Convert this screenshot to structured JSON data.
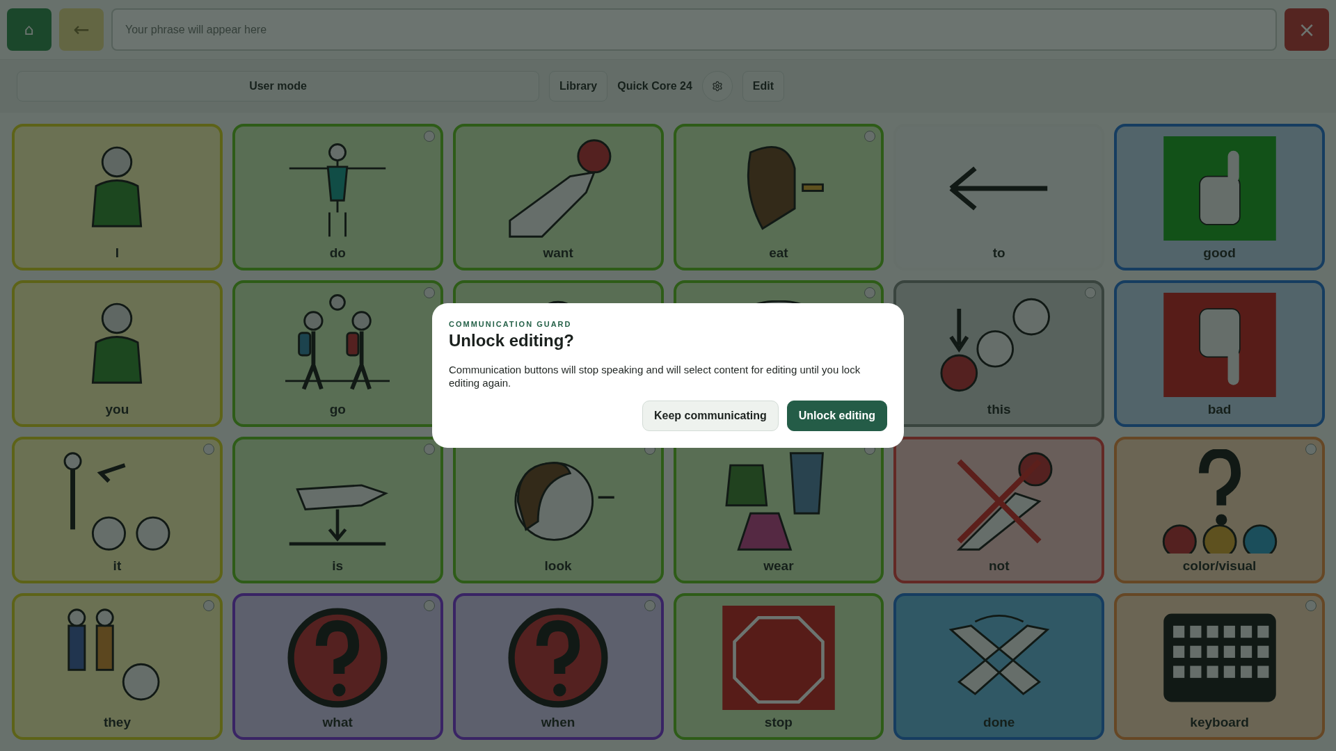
{
  "top_bar": {
    "home_button": "⌂",
    "back_button": "←",
    "phrase_field": {
      "placeholder": "Your phrase will appear here"
    },
    "clear_button": "×"
  },
  "toolbar": {
    "mode_field": "User mode",
    "library_button": "Library",
    "board_name": "Quick Core 24",
    "edit_button": "Edit"
  },
  "tiles": [
    {
      "label": "I",
      "kind": "pronoun",
      "linked": false
    },
    {
      "label": "do",
      "kind": "verb",
      "linked": true
    },
    {
      "label": "want",
      "kind": "verb",
      "linked": false
    },
    {
      "label": "eat",
      "kind": "verb",
      "linked": true
    },
    {
      "label": "to",
      "kind": "preposition",
      "linked": false
    },
    {
      "label": "good",
      "kind": "descriptor",
      "linked": false
    },
    {
      "label": "you",
      "kind": "pronoun",
      "linked": false
    },
    {
      "label": "go",
      "kind": "verb",
      "linked": true
    },
    {
      "kind": "verb",
      "linked": false
    },
    {
      "kind": "verb",
      "linked": true
    },
    {
      "label": "this",
      "kind": "determiner",
      "linked": true
    },
    {
      "label": "bad",
      "kind": "descriptor",
      "linked": false
    },
    {
      "label": "it",
      "kind": "pronoun",
      "linked": true
    },
    {
      "label": "is",
      "kind": "verb",
      "linked": true
    },
    {
      "label": "look",
      "kind": "verb",
      "linked": true
    },
    {
      "label": "wear",
      "kind": "verb",
      "linked": true
    },
    {
      "label": "not",
      "kind": "negation",
      "linked": false
    },
    {
      "label": "color/visual",
      "kind": "noun",
      "linked": true
    },
    {
      "label": "they",
      "kind": "pronoun",
      "linked": true
    },
    {
      "label": "what",
      "kind": "question",
      "linked": true
    },
    {
      "label": "when",
      "kind": "question",
      "linked": true
    },
    {
      "label": "stop",
      "kind": "verb",
      "linked": false
    },
    {
      "label": "done",
      "kind": "social",
      "linked": false
    },
    {
      "label": "keyboard",
      "kind": "noun",
      "linked": true
    }
  ],
  "dialog": {
    "eyebrow": "COMMUNICATION GUARD",
    "title": "Unlock editing?",
    "message": "Communication buttons will stop speaking and will select content for editing until you lock editing again.",
    "buttons": [
      {
        "label": "Keep communicating",
        "kind": "secondary"
      },
      {
        "label": "Unlock editing",
        "kind": "primary"
      }
    ]
  }
}
